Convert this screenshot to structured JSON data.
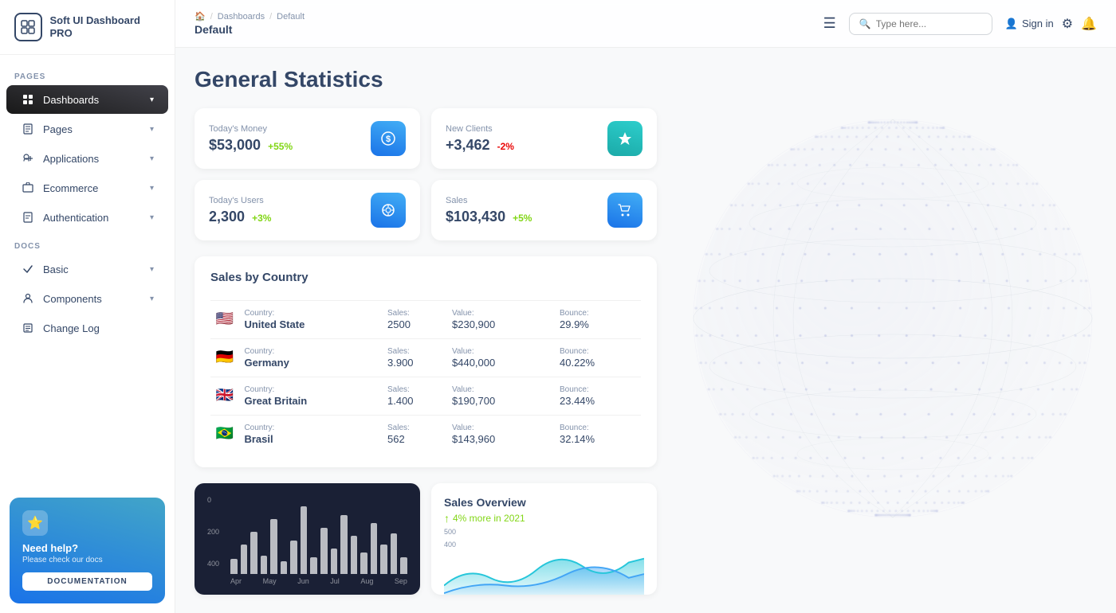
{
  "app": {
    "name": "Soft UI Dashboard PRO"
  },
  "sidebar": {
    "section_pages": "PAGES",
    "section_docs": "DOCS",
    "items_pages": [
      {
        "id": "dashboards",
        "label": "Dashboards",
        "icon": "📊",
        "active": true,
        "hasChevron": true
      },
      {
        "id": "pages",
        "label": "Pages",
        "icon": "📋",
        "active": false,
        "hasChevron": true
      },
      {
        "id": "applications",
        "label": "Applications",
        "icon": "🔧",
        "active": false,
        "hasChevron": true
      },
      {
        "id": "ecommerce",
        "label": "Ecommerce",
        "icon": "🛒",
        "active": false,
        "hasChevron": true
      },
      {
        "id": "authentication",
        "label": "Authentication",
        "icon": "📄",
        "active": false,
        "hasChevron": true
      }
    ],
    "items_docs": [
      {
        "id": "basic",
        "label": "Basic",
        "icon": "🚀",
        "active": false,
        "hasChevron": true
      },
      {
        "id": "components",
        "label": "Components",
        "icon": "👥",
        "active": false,
        "hasChevron": true
      },
      {
        "id": "changelog",
        "label": "Change Log",
        "icon": "📰",
        "active": false,
        "hasChevron": false
      }
    ],
    "help": {
      "title": "Need help?",
      "subtitle": "Please check our docs",
      "button_label": "DOCUMENTATION"
    }
  },
  "topbar": {
    "breadcrumb": {
      "home_icon": "🏠",
      "sep1": "/",
      "dashboards": "Dashboards",
      "sep2": "/",
      "current": "Default"
    },
    "page_title": "Default",
    "search_placeholder": "Type here...",
    "sign_in": "Sign in"
  },
  "main": {
    "title": "General Statistics",
    "stats": [
      {
        "id": "money",
        "label": "Today's Money",
        "value": "$53,000",
        "change": "+55%",
        "change_type": "positive",
        "icon": "💵",
        "icon_style": "blue"
      },
      {
        "id": "clients",
        "label": "New Clients",
        "value": "+3,462",
        "change": "-2%",
        "change_type": "negative",
        "icon": "🏆",
        "icon_style": "teal"
      },
      {
        "id": "users",
        "label": "Today's Users",
        "value": "2,300",
        "change": "+3%",
        "change_type": "positive",
        "icon": "🌐",
        "icon_style": "blue"
      },
      {
        "id": "sales",
        "label": "Sales",
        "value": "$103,430",
        "change": "+5%",
        "change_type": "positive",
        "icon": "🛒",
        "icon_style": "blue"
      }
    ],
    "sales_by_country": {
      "title": "Sales by Country",
      "columns": [
        "Country:",
        "Sales:",
        "Value:",
        "Bounce:"
      ],
      "rows": [
        {
          "flag": "🇺🇸",
          "country": "United State",
          "sales": "2500",
          "value": "$230,900",
          "bounce": "29.9%"
        },
        {
          "flag": "🇩🇪",
          "country": "Germany",
          "sales": "3.900",
          "value": "$440,000",
          "bounce": "40.22%"
        },
        {
          "flag": "🇬🇧",
          "country": "Great Britain",
          "sales": "1.400",
          "value": "$190,700",
          "bounce": "23.44%"
        },
        {
          "flag": "🇧🇷",
          "country": "Brasil",
          "sales": "562",
          "value": "$143,960",
          "bounce": "32.14%"
        }
      ]
    },
    "bar_chart": {
      "y_labels": [
        "400",
        "200",
        "0"
      ],
      "bars": [
        18,
        35,
        50,
        22,
        65,
        15,
        40,
        80,
        20,
        55,
        30,
        70,
        45,
        25,
        60,
        35,
        48,
        20
      ],
      "x_labels": [
        "Apr",
        "May",
        "Jun",
        "Jul",
        "Aug",
        "Sep"
      ]
    },
    "sales_overview": {
      "title": "Sales Overview",
      "subtitle": "4% more in 2021",
      "y_labels": [
        "500",
        "400"
      ]
    }
  }
}
